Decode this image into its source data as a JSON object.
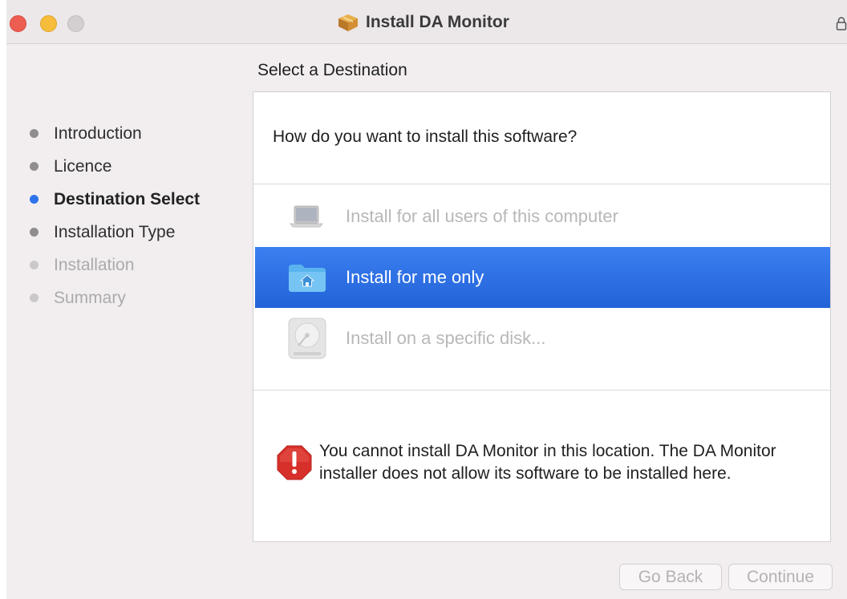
{
  "window": {
    "title": "Install DA Monitor"
  },
  "sidebar": {
    "steps": [
      {
        "label": "Introduction",
        "state": "done"
      },
      {
        "label": "Licence",
        "state": "done"
      },
      {
        "label": "Destination Select",
        "state": "current"
      },
      {
        "label": "Installation Type",
        "state": "done"
      },
      {
        "label": "Installation",
        "state": "future"
      },
      {
        "label": "Summary",
        "state": "future"
      }
    ]
  },
  "main": {
    "section_title": "Select a Destination",
    "question": "How do you want to install this software?",
    "options": [
      {
        "label": "Install for all users of this computer",
        "icon": "laptop-icon",
        "state": "disabled"
      },
      {
        "label": "Install for me only",
        "icon": "home-folder-icon",
        "state": "selected"
      },
      {
        "label": "Install on a specific disk...",
        "icon": "disk-icon",
        "state": "disabled"
      }
    ],
    "warning": {
      "icon": "stop-warning-icon",
      "text": "You cannot install DA Monitor in this location. The DA Monitor installer does not allow its software to be installed here."
    }
  },
  "footer": {
    "back_label": "Go Back",
    "continue_label": "Continue"
  },
  "colors": {
    "accent": "#2f73ea",
    "selection": "#2c6fe3",
    "close": "#ee5d52",
    "minimize": "#f5bd3b",
    "warning": "#d7302a"
  }
}
